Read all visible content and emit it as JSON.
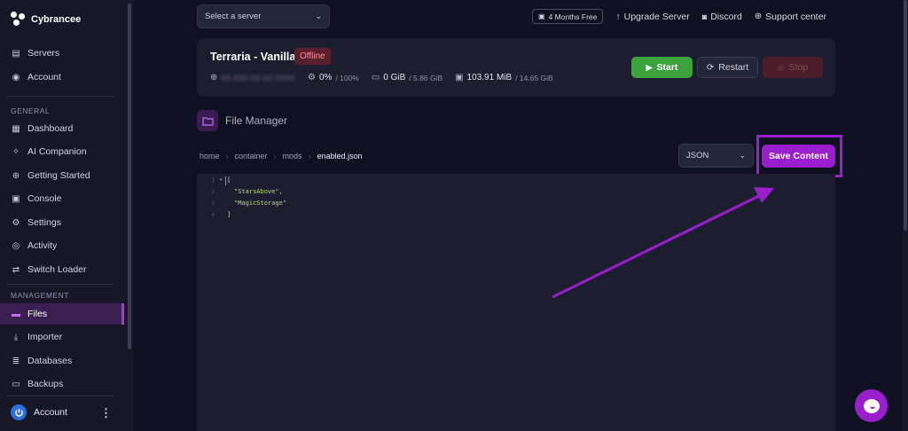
{
  "brand": {
    "name": "Cybrancee"
  },
  "sidebar": {
    "top_items": [
      {
        "label": "Servers",
        "icon": "server-icon"
      },
      {
        "label": "Account",
        "icon": "user-circle-icon"
      }
    ],
    "general_label": "GENERAL",
    "general_items": [
      {
        "label": "Dashboard",
        "icon": "grid-icon"
      },
      {
        "label": "AI Companion",
        "icon": "sparkle-icon"
      },
      {
        "label": "Getting Started",
        "icon": "compass-icon"
      },
      {
        "label": "Console",
        "icon": "terminal-icon"
      },
      {
        "label": "Settings",
        "icon": "gear-icon"
      },
      {
        "label": "Activity",
        "icon": "eye-icon"
      },
      {
        "label": "Switch Loader",
        "icon": "swap-icon"
      }
    ],
    "management_label": "MANAGEMENT",
    "management_items": [
      {
        "label": "Files",
        "icon": "folder-icon",
        "active": true
      },
      {
        "label": "Importer",
        "icon": "download-icon"
      },
      {
        "label": "Databases",
        "icon": "database-icon"
      },
      {
        "label": "Backups",
        "icon": "archive-icon"
      }
    ],
    "footer_account": "Account"
  },
  "topbar": {
    "server_select_placeholder": "Select a server",
    "promo": "4 Months Free",
    "upgrade": "Upgrade Server",
    "discord": "Discord",
    "support": "Support center"
  },
  "server": {
    "name": "Terraria - Vanilla",
    "status": "Offline",
    "ip": "00.000.00.00:0000",
    "cpu": "0%",
    "cpu_limit": "/ 100%",
    "memory": "0 GiB",
    "memory_limit": "/ 5.86 GiB",
    "disk": "103.91 MiB",
    "disk_limit": "/ 14.65 GiB",
    "start_label": "Start",
    "restart_label": "Restart",
    "stop_label": "Stop"
  },
  "file_manager": {
    "title": "File Manager",
    "breadcrumb": [
      "home",
      "container",
      "mods"
    ],
    "current_file": "enabled.json",
    "language": "JSON",
    "save_label": "Save Content"
  },
  "editor": {
    "lines": [
      {
        "no": "1",
        "text": "["
      },
      {
        "no": "2",
        "text": "\"StarsAbove\","
      },
      {
        "no": "3",
        "text": "\"MagicStorage\""
      },
      {
        "no": "4",
        "text": "]"
      }
    ]
  },
  "colors": {
    "accent": "#9a1fcc",
    "start": "#3ca33c",
    "offline": "#ff8d9b"
  }
}
